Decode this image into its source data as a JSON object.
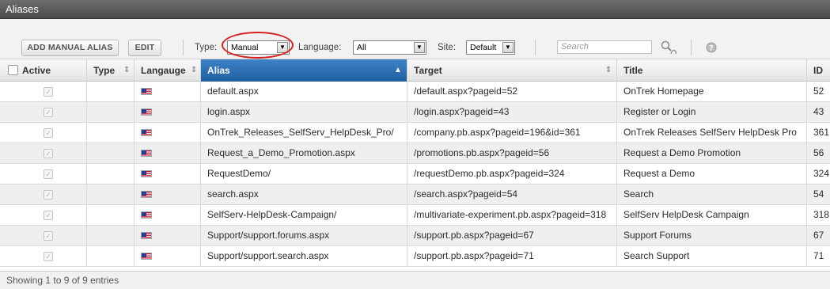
{
  "window": {
    "title": "Aliases"
  },
  "toolbar": {
    "add_manual_alias_label": "ADD MANUAL ALIAS",
    "edit_label": "EDIT",
    "type_label": "Type:",
    "type_value": "Manual",
    "language_label": "Language:",
    "language_value": "All",
    "site_label": "Site:",
    "site_value": "Default",
    "search_placeholder": "Search",
    "highlight_color": "#d62020"
  },
  "table": {
    "headers": {
      "active": "Active",
      "type": "Type",
      "language": "Langauge",
      "alias": "Alias",
      "target": "Target",
      "title": "Title",
      "id": "ID"
    },
    "sorted_column": "alias",
    "rows": [
      {
        "alias": "default.aspx",
        "target": "/default.aspx?pageid=52",
        "title": "OnTrek Homepage",
        "id": "52"
      },
      {
        "alias": "login.aspx",
        "target": "/login.aspx?pageid=43",
        "title": "Register or Login",
        "id": "43"
      },
      {
        "alias": "OnTrek_Releases_SelfServ_HelpDesk_Pro/",
        "target": "/company.pb.aspx?pageid=196&id=361",
        "title": "OnTrek Releases SelfServ HelpDesk Pro",
        "id": "361"
      },
      {
        "alias": "Request_a_Demo_Promotion.aspx",
        "target": "/promotions.pb.aspx?pageid=56",
        "title": "Request a Demo Promotion",
        "id": "56"
      },
      {
        "alias": "RequestDemo/",
        "target": "/requestDemo.pb.aspx?pageid=324",
        "title": "Request a Demo",
        "id": "324"
      },
      {
        "alias": "search.aspx",
        "target": "/search.aspx?pageid=54",
        "title": "Search",
        "id": "54"
      },
      {
        "alias": "SelfServ-HelpDesk-Campaign/",
        "target": "/multivariate-experiment.pb.aspx?pageid=318",
        "title": "SelfServ HelpDesk Campaign",
        "id": "318"
      },
      {
        "alias": "Support/support.forums.aspx",
        "target": "/support.pb.aspx?pageid=67",
        "title": "Support Forums",
        "id": "67"
      },
      {
        "alias": "Support/support.search.aspx",
        "target": "/support.pb.aspx?pageid=71",
        "title": "Search Support",
        "id": "71"
      }
    ]
  },
  "footer": {
    "entries_text": "Showing 1 to 9 of 9 entries"
  }
}
